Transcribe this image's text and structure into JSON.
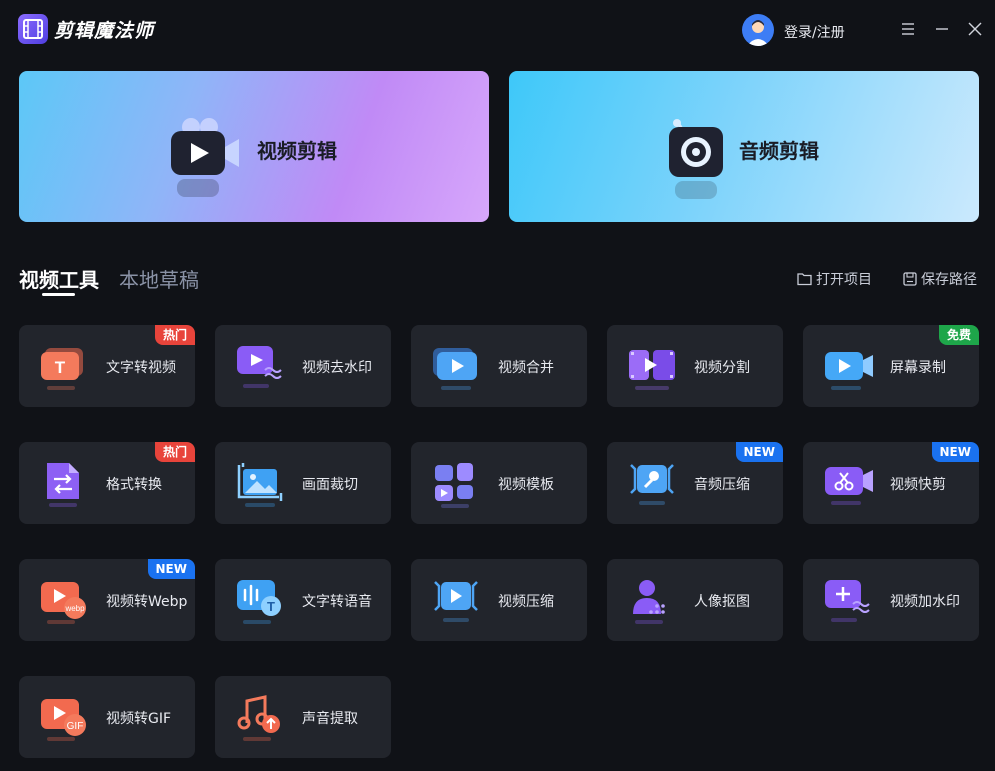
{
  "app": {
    "title": "剪辑魔法师"
  },
  "header": {
    "login_label": "登录/注册"
  },
  "banners": [
    {
      "label": "视频剪辑",
      "icon": "video-camera-icon"
    },
    {
      "label": "音频剪辑",
      "icon": "audio-speaker-icon"
    }
  ],
  "tabs": [
    {
      "label": "视频工具",
      "active": true
    },
    {
      "label": "本地草稿",
      "active": false
    }
  ],
  "actions": {
    "open_project": "打开项目",
    "save_path": "保存路径"
  },
  "tools": [
    {
      "label": "文字转视频",
      "badge": "热门",
      "badge_type": "hot",
      "icon": "text-to-video-icon"
    },
    {
      "label": "视频去水印",
      "badge": "",
      "badge_type": "",
      "icon": "remove-watermark-icon"
    },
    {
      "label": "视频合并",
      "badge": "",
      "badge_type": "",
      "icon": "video-merge-icon"
    },
    {
      "label": "视频分割",
      "badge": "",
      "badge_type": "",
      "icon": "video-split-icon"
    },
    {
      "label": "屏幕录制",
      "badge": "免费",
      "badge_type": "free",
      "icon": "screen-record-icon"
    },
    {
      "label": "格式转换",
      "badge": "热门",
      "badge_type": "hot",
      "icon": "format-convert-icon"
    },
    {
      "label": "画面裁切",
      "badge": "",
      "badge_type": "",
      "icon": "crop-icon"
    },
    {
      "label": "视频模板",
      "badge": "",
      "badge_type": "",
      "icon": "video-template-icon"
    },
    {
      "label": "音频压缩",
      "badge": "NEW",
      "badge_type": "new",
      "icon": "audio-compress-icon"
    },
    {
      "label": "视频快剪",
      "badge": "NEW",
      "badge_type": "new",
      "icon": "quick-cut-icon"
    },
    {
      "label": "视频转Webp",
      "badge": "NEW",
      "badge_type": "new",
      "icon": "video-to-webp-icon"
    },
    {
      "label": "文字转语音",
      "badge": "",
      "badge_type": "",
      "icon": "text-to-speech-icon"
    },
    {
      "label": "视频压缩",
      "badge": "",
      "badge_type": "",
      "icon": "video-compress-icon"
    },
    {
      "label": "人像抠图",
      "badge": "",
      "badge_type": "",
      "icon": "portrait-cutout-icon"
    },
    {
      "label": "视频加水印",
      "badge": "",
      "badge_type": "",
      "icon": "add-watermark-icon"
    },
    {
      "label": "视频转GIF",
      "badge": "",
      "badge_type": "",
      "icon": "video-to-gif-icon"
    },
    {
      "label": "声音提取",
      "badge": "",
      "badge_type": "",
      "icon": "audio-extract-icon"
    }
  ],
  "icon_text": {
    "webp": "webp",
    "gif": "GIF",
    "text_tile": "T"
  },
  "colors": {
    "background": "#101217",
    "card": "#22252c",
    "hot": "#e8443b",
    "free": "#1ea64a",
    "new": "#1a72f0"
  }
}
